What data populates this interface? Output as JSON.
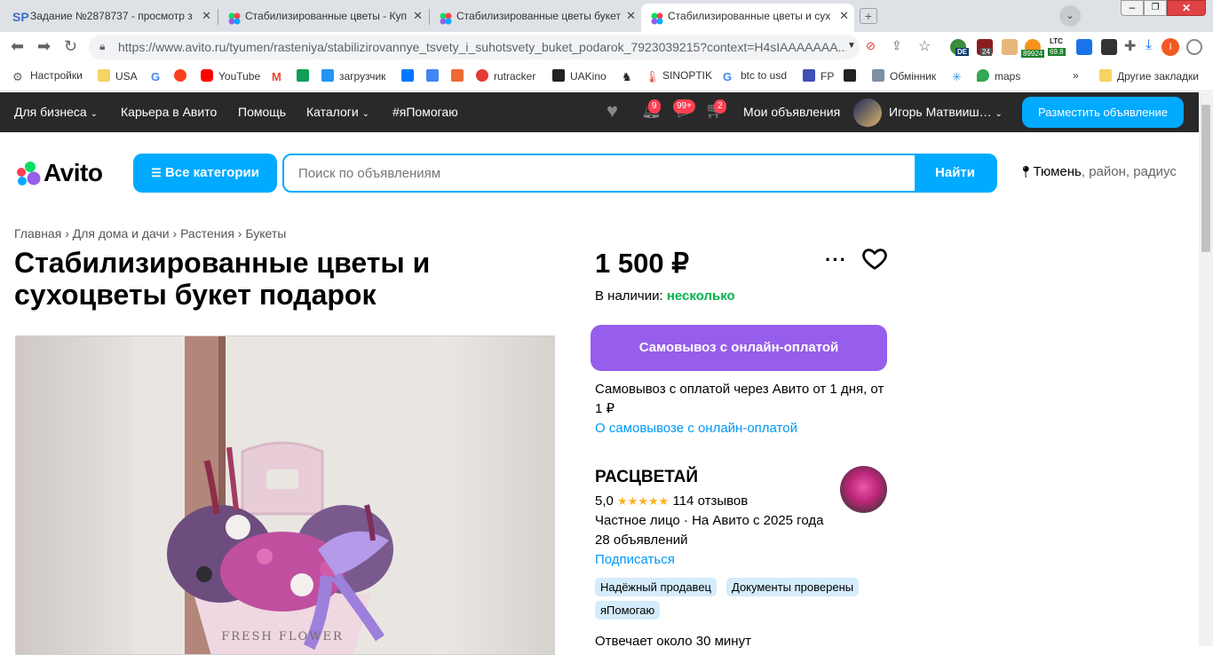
{
  "browser": {
    "tabs": [
      {
        "title": "Задание №2878737 - просмотр з"
      },
      {
        "title": "Стабилизированные цветы - Куп"
      },
      {
        "title": "Стабилизированные цветы букет"
      },
      {
        "title": "Стабилизированные цветы и сух"
      }
    ],
    "url": "https://www.avito.ru/tyumen/rasteniya/stabilizirovannye_tsvety_i_suhotsvety_buket_podarok_7923039215?context=H4sIAAAAAAA...",
    "ext_labels": {
      "de": "DE",
      "num24": "24",
      "btc": "89924",
      "ltc_top": "LTC",
      "ltc": "69.8",
      "profile": "I"
    },
    "bookmarks": [
      "Настройки",
      "USA",
      "",
      "",
      "YouTube",
      "",
      "",
      "загрузчик",
      "",
      "",
      "",
      "rutracker",
      "UAKino",
      "",
      "SINOPTIK",
      "btc to usd",
      "FP",
      "",
      "Обмінник",
      "",
      "maps"
    ],
    "more": "»",
    "other_bookmarks": "Другие закладки"
  },
  "topnav": {
    "business": "Для бизнеса",
    "career": "Карьера в Авито",
    "help": "Помощь",
    "catalogs": "Каталоги",
    "help_hashtag": "#яПомогаю",
    "badge_notifications": "9",
    "badge_messages": "99+",
    "badge_cart": "2",
    "my_ads": "Мои объявления",
    "user_name": "Игорь Матвииш…",
    "post_button": "Разместить объявление"
  },
  "logo": {
    "text": "Avito"
  },
  "search": {
    "all_categories": "Все категории",
    "placeholder": "Поиск по объявлениям",
    "button": "Найти",
    "location_city": "Тюмень",
    "location_rest": ", район, радиус"
  },
  "breadcrumb": [
    "Главная",
    "Для дома и дачи",
    "Растения",
    "Букеты"
  ],
  "listing": {
    "title": "Стабилизированные цветы и сухоцветы букет подарок",
    "price": "1 500 ₽",
    "stock_label": "В наличии: ",
    "stock_value": "несколько",
    "pickup_button": "Самовывоз с онлайн-оплатой",
    "pickup_desc": "Самовывоз с оплатой через Авито от 1 дня, от 1 ₽",
    "pickup_link": "О самовывозе с онлайн-оплатой",
    "photo_text": "FRESH FLOWER"
  },
  "seller": {
    "name": "РАСЦВЕТАЙ",
    "rating": "5,0",
    "stars": "★★★★★",
    "reviews": "114 отзывов",
    "type": "Частное лицо · На Авито с 2025 года",
    "ads_count": "28 объявлений",
    "subscribe": "Подписаться",
    "tags": [
      "Надёжный продавец",
      "Документы проверены",
      "яПомогаю"
    ],
    "response": "Отвечает около 30 минут"
  },
  "colors": {
    "accent": "#00aaff",
    "pickup": "#965eeb",
    "in_stock": "#02b34f",
    "nav_bg": "#292929"
  }
}
